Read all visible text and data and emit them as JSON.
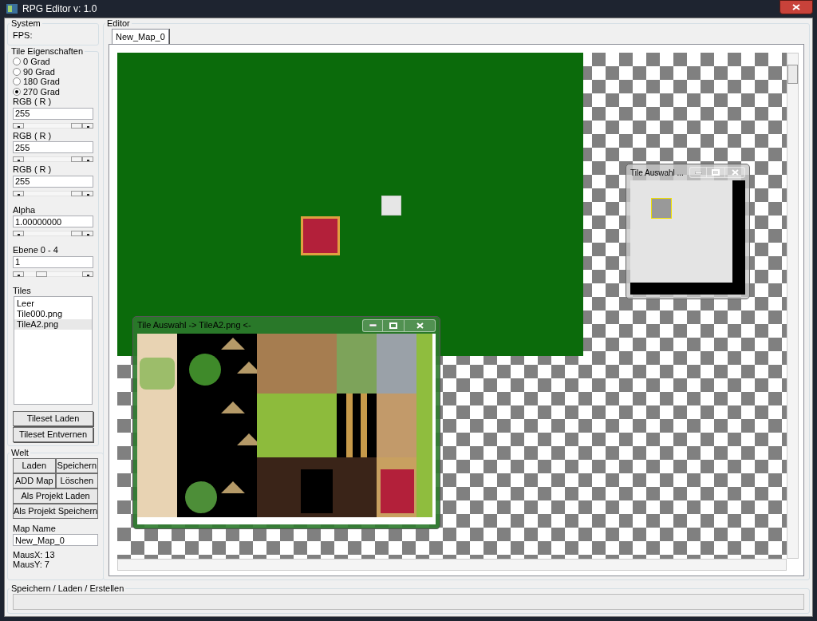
{
  "window": {
    "title": "RPG Editor v: 1.0"
  },
  "system": {
    "title": "System",
    "fps_label": "FPS:"
  },
  "tile_properties": {
    "title": "Tile Eigenschaften",
    "rotations": [
      {
        "label": "0 Grad",
        "selected": false
      },
      {
        "label": "90 Grad",
        "selected": false
      },
      {
        "label": "180 Grad",
        "selected": false
      },
      {
        "label": "270 Grad",
        "selected": true
      }
    ],
    "fields": [
      {
        "label": "RGB ( R )",
        "value": "255",
        "level": 1
      },
      {
        "label": "RGB ( R )",
        "value": "255",
        "level": 1
      },
      {
        "label": "RGB ( R )",
        "value": "255",
        "level": 1
      },
      {
        "label": "Alpha",
        "value": "1.00000000",
        "level": 1
      },
      {
        "label": "Ebene 0 - 4",
        "value": "1",
        "level": 0.25
      }
    ]
  },
  "tiles": {
    "label": "Tiles",
    "items": [
      {
        "label": "Leer",
        "selected": false
      },
      {
        "label": "Tile000.png",
        "selected": false
      },
      {
        "label": "TileA2.png",
        "selected": true
      }
    ],
    "buttons": [
      "Tileset Laden",
      "Tileset Entvernen"
    ]
  },
  "world": {
    "title": "Welt",
    "buttons": [
      {
        "label": "Laden",
        "kind": "half"
      },
      {
        "label": "Speichern",
        "kind": "half"
      },
      {
        "label": "ADD Map",
        "kind": "half"
      },
      {
        "label": "Löschen",
        "kind": "half"
      },
      {
        "label": "Als Projekt Laden",
        "kind": "wide"
      },
      {
        "label": "Als Projekt Speichern",
        "kind": "wide"
      }
    ],
    "map_name_label": "Map Name",
    "map_name": "New_Map_0",
    "mouse_x": "MausX: 13",
    "mouse_y": "MausY: 7"
  },
  "editor": {
    "title": "Editor",
    "tabs": [
      {
        "label": "New_Map_0",
        "selected": true
      }
    ]
  },
  "tile_windows": [
    {
      "title": "Tile Auswahl ..."
    },
    {
      "title": "Tile Auswahl -> TileA2.png <-"
    }
  ],
  "status": {
    "title": "Speichern / Laden / Erstellen"
  }
}
